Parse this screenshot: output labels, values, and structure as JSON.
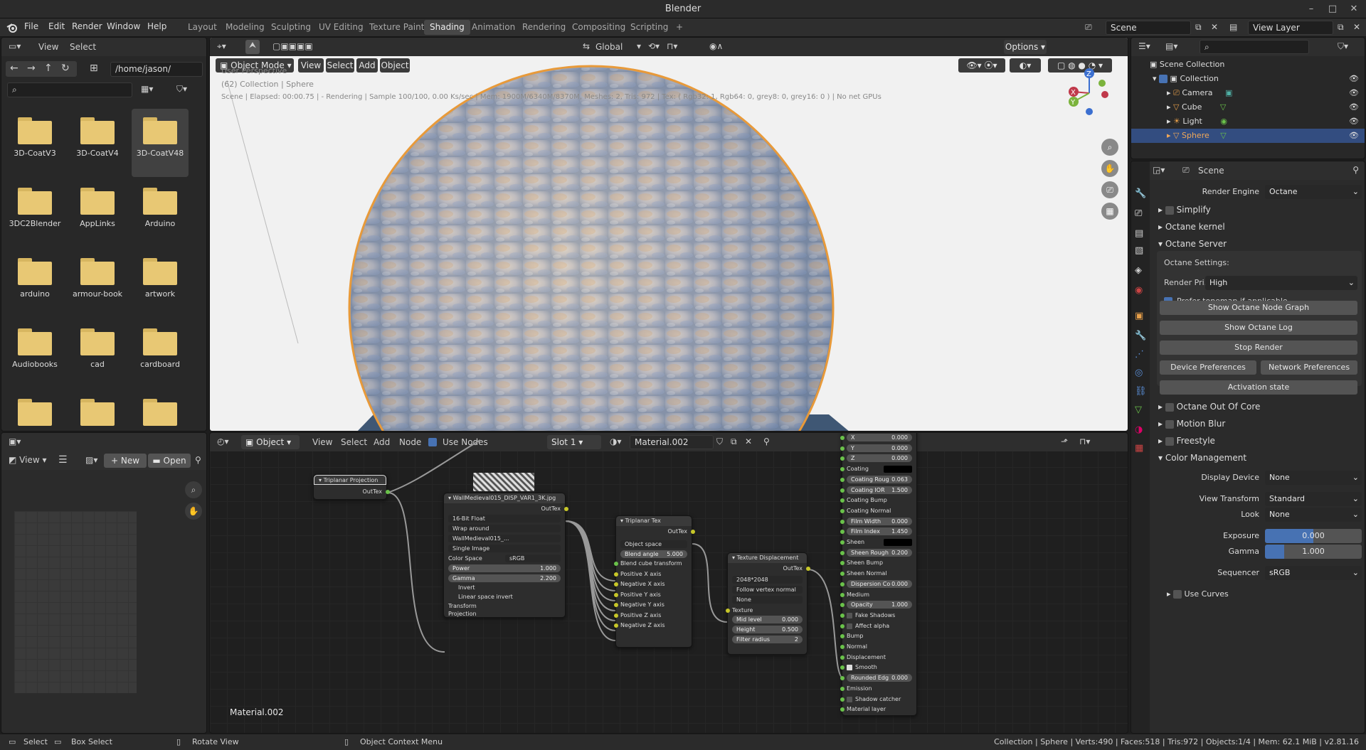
{
  "titlebar": {
    "title": "Blender",
    "min": "–",
    "max": "□",
    "close": "✕"
  },
  "menu": [
    "File",
    "Edit",
    "Render",
    "Window",
    "Help"
  ],
  "workspaces": [
    "Layout",
    "Modeling",
    "Sculpting",
    "UV Editing",
    "Texture Paint",
    "Shading",
    "Animation",
    "Rendering",
    "Compositing",
    "Scripting",
    "+"
  ],
  "scene_field": "Scene",
  "view_layer_field": "View Layer",
  "filebrowser": {
    "menu": [
      "View",
      "Select"
    ],
    "path": "/home/jason/",
    "folders": [
      "3D-CoatV3",
      "3D-CoatV4",
      "3D-CoatV48",
      "3DC2Blender",
      "AppLinks",
      "Arduino",
      "arduino",
      "armour-book",
      "artwork",
      "Audiobooks",
      "cad",
      "cardboard",
      "",
      "",
      ""
    ]
  },
  "viewport": {
    "mode": "Object Mode",
    "menu": [
      "View",
      "Select",
      "Add",
      "Object"
    ],
    "orientation": "Global",
    "options": "Options",
    "info1": "User Perspective",
    "info2": "(62) Collection | Sphere",
    "info3": "Scene | Elapsed: 00:00.75 | - Rendering | Sample 100/100, 0.00 Ks/sec | Mem: 1900M/6340M/8370M, Meshes: 2, Tris: 972 | Tex: ( Rgb32: 1, Rgb64: 0, grey8: 0, grey16: 0 ) | No net GPUs",
    "axis": {
      "x": "X",
      "y": "Y",
      "z": "Z"
    }
  },
  "image_editor": {
    "view": "View",
    "new": "New",
    "open": "Open"
  },
  "node_editor": {
    "object": "Object",
    "menu": [
      "View",
      "Select",
      "Add",
      "Node"
    ],
    "use_nodes": "Use Nodes",
    "slot": "Slot 1",
    "material": "Material.002",
    "bottom_label": "Material.002",
    "nodes": {
      "triplanar_proj": {
        "title": "Triplanar Projection",
        "out": "OutTex"
      },
      "image": {
        "title": "WallMedieval015_DISP_VAR1_3K.jpg",
        "out": "OutTex",
        "f1": "16-Bit Float",
        "f2": "Wrap around",
        "img": "WallMedieval015_...",
        "f3": "Single Image",
        "cs_label": "Color Space",
        "cs": "sRGB",
        "power_label": "Power",
        "power": "1.000",
        "gamma_label": "Gamma",
        "gamma": "2.200",
        "invert": "Invert",
        "linear": "Linear space invert",
        "transform": "Transform",
        "projection": "Projection"
      },
      "triplanar_tex": {
        "title": "Triplanar Tex",
        "out": "OutTex",
        "space": "Object space",
        "blend_label": "Blend angle",
        "blend": "5.000",
        "rows": [
          "Blend cube transform",
          "Positive X axis",
          "Negative X axis",
          "Positive Y axis",
          "Negative Y axis",
          "Positive Z axis",
          "Negative Z axis"
        ]
      },
      "tex_disp": {
        "title": "Texture Displacement",
        "out": "OutTex",
        "res": "2048*2048",
        "follow": "Follow vertex normal",
        "none": "None",
        "texture": "Texture",
        "mid_label": "Mid level",
        "mid": "0.000",
        "height_label": "Height",
        "height": "0.500",
        "filter_label": "Filter radius",
        "filter": "2"
      },
      "material": {
        "x_label": "X",
        "x": "0.000",
        "y_label": "Y",
        "y": "0.000",
        "z_label": "Z",
        "z": "0.000",
        "coating": "Coating",
        "coat_rough_label": "Coating Roug",
        "coat_rough": "0.063",
        "coat_ior_label": "Coating IOR",
        "coat_ior": "1.500",
        "coat_bump": "Coating Bump",
        "coat_normal": "Coating Normal",
        "film_w_label": "Film Width",
        "film_w": "0.000",
        "film_i_label": "Film Index",
        "film_i": "1.450",
        "sheen": "Sheen",
        "sheen_rough_label": "Sheen Rough",
        "sheen_rough": "0.200",
        "sheen_bump": "Sheen Bump",
        "sheen_normal": "Sheen Normal",
        "disp_co_label": "Dispersion Co",
        "disp_co": "0.000",
        "medium": "Medium",
        "opacity_label": "Opacity",
        "opacity": "1.000",
        "fake_shadows": "Fake Shadows",
        "affect_alpha": "Affect alpha",
        "bump": "Bump",
        "normal": "Normal",
        "displacement": "Displacement",
        "smooth": "Smooth",
        "rounded_label": "Rounded Edg",
        "rounded": "0.000",
        "emission": "Emission",
        "shadow_catcher": "Shadow catcher",
        "material_layer": "Material layer"
      }
    }
  },
  "outliner": {
    "root": "Scene Collection",
    "items": [
      "Collection",
      "Camera",
      "Cube",
      "Light",
      "Sphere"
    ]
  },
  "properties": {
    "scene": "Scene",
    "render_engine_label": "Render Engine",
    "render_engine": "Octane",
    "simplify": "Simplify",
    "octane_kernel": "Octane kernel",
    "octane_server": "Octane Server",
    "octane_settings": "Octane Settings:",
    "render_pri_label": "Render Pri...",
    "render_pri": "High",
    "prefer_tonemap": "Prefer tonemap if applicable",
    "show_node_graph": "Show Octane Node Graph",
    "show_log": "Show Octane Log",
    "stop_render": "Stop Render",
    "device_prefs": "Device Preferences",
    "network_prefs": "Network Preferences",
    "activation": "Activation state",
    "out_of_core": "Octane Out Of Core",
    "motion_blur": "Motion Blur",
    "freestyle": "Freestyle",
    "color_mgmt": "Color Management",
    "display_device_label": "Display Device",
    "display_device": "None",
    "view_transform_label": "View Transform",
    "view_transform": "Standard",
    "look_label": "Look",
    "look": "None",
    "exposure_label": "Exposure",
    "exposure": "0.000",
    "gamma_label": "Gamma",
    "gamma": "1.000",
    "sequencer_label": "Sequencer",
    "sequencer": "sRGB",
    "use_curves": "Use Curves"
  },
  "statusbar": {
    "select": "Select",
    "box_select": "Box Select",
    "rotate": "Rotate View",
    "context": "Object Context Menu",
    "stats": "Collection | Sphere | Verts:490 | Faces:518 | Tris:972 | Objects:1/4 | Mem: 62.1 MiB | v2.81.16"
  },
  "colors": {
    "accent": "#4772b3",
    "selected": "#334d80",
    "orange": "#e8a04a",
    "socket_green": "#6ac24a",
    "socket_yellow": "#c7c729"
  }
}
